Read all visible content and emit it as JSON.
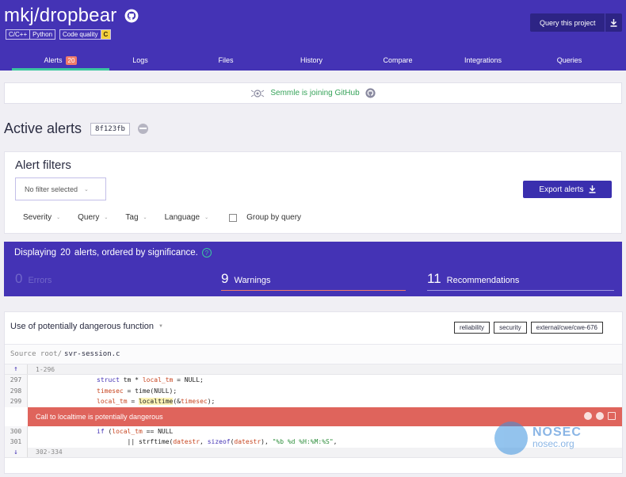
{
  "repo": {
    "title": "mkj/dropbear"
  },
  "badges": {
    "languages": [
      "C/C++",
      "Python"
    ],
    "quality_label": "Code quality",
    "quality_grade": "C"
  },
  "header": {
    "query_button": "Query this project"
  },
  "tabs": [
    {
      "label": "Alerts",
      "count": "20",
      "active": true
    },
    {
      "label": "Logs"
    },
    {
      "label": "Files"
    },
    {
      "label": "History"
    },
    {
      "label": "Compare"
    },
    {
      "label": "Integrations"
    },
    {
      "label": "Queries"
    }
  ],
  "banner": {
    "text": "Semmle is joining GitHub"
  },
  "active_alerts": {
    "title": "Active alerts",
    "commit": "8f123fb"
  },
  "filters": {
    "title": "Alert filters",
    "select_value": "No filter selected",
    "export_label": "Export alerts",
    "dropdowns": [
      "Severity",
      "Query",
      "Tag",
      "Language"
    ],
    "group_by_label": "Group by query"
  },
  "summary": {
    "prefix": "Displaying",
    "count": "20",
    "suffix": "alerts, ordered by significance.",
    "errors": {
      "num": "0",
      "label": "Errors"
    },
    "warnings": {
      "num": "9",
      "label": "Warnings"
    },
    "recommendations": {
      "num": "11",
      "label": "Recommendations"
    }
  },
  "alert": {
    "title": "Use of potentially dangerous function",
    "tags": [
      "reliability",
      "security",
      "external/cwe/cwe-676"
    ],
    "source_prefix": "Source root/",
    "source_path": "svr-session.c",
    "fold_top": "1-296",
    "fold_bottom": "302-334",
    "lines": [
      {
        "ln": "297",
        "code": "struct tm * local_tm = NULL;"
      },
      {
        "ln": "298",
        "code": "timesec = time(NULL);"
      },
      {
        "ln": "299",
        "code": "local_tm = localtime(&timesec);"
      }
    ],
    "message": "Call to localtime is potentially dangerous",
    "lines_after": [
      {
        "ln": "300",
        "code": "if (local_tm == NULL"
      },
      {
        "ln": "301",
        "code": "        || strftime(datestr, sizeof(datestr), \"%b %d %H:%M:%S\","
      }
    ]
  },
  "watermark": {
    "line1": "NOSEC",
    "line2": "nosec.org"
  },
  "colors": {
    "primary": "#4433b5",
    "accent": "#3cc6a0",
    "error": "#df645c",
    "link": "#37a35a"
  }
}
